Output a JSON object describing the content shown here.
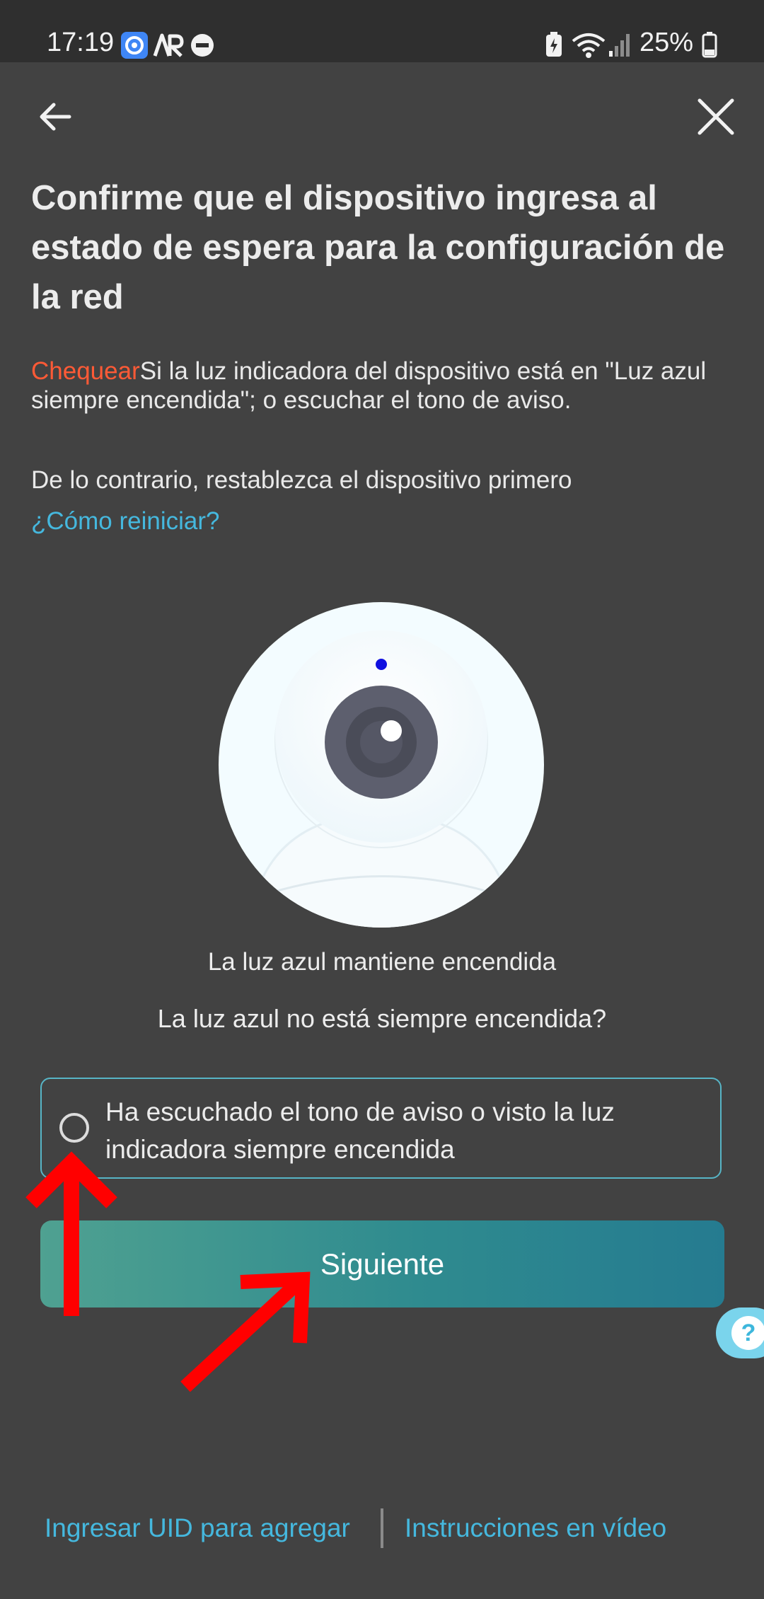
{
  "status_bar": {
    "time": "17:19",
    "battery": "25%",
    "icons": [
      "app-badge-icon",
      "ar-icon",
      "do-not-disturb-icon",
      "battery-saver-icon",
      "wifi-icon",
      "signal-icon",
      "battery-icon"
    ]
  },
  "nav": {
    "back_icon": "arrow-left-icon",
    "close_icon": "close-icon"
  },
  "title": "Confirme que el dispositivo ingresa al estado de espera para la configuración de la red",
  "instructions": {
    "highlight": "Chequear",
    "text": "Si la luz indicadora del dispositivo está en \"Luz azul siempre encendida\"; o escuchar el tono de aviso.",
    "otherwise": "De lo contrario, restablezca el dispositivo primero",
    "reset_link": "¿Cómo reiniciar?"
  },
  "illustration": {
    "caption": "La luz azul mantiene encendida",
    "indicator_color": "#1010e0"
  },
  "light_not_on_link": "La luz azul no está siempre encendida?",
  "confirm_option": {
    "label": "Ha escuchado el tono de aviso o visto la luz indicadora siempre encendida",
    "checked": false
  },
  "next_button": "Siguiente",
  "help_button": "?",
  "footer": {
    "uid_link": "Ingresar UID para agregar",
    "video_link": "Instrucciones en vídeo"
  },
  "colors": {
    "background": "#424242",
    "accent_link": "#45b8de",
    "highlight": "#ff5a36",
    "annotation_arrow": "#ff0000"
  }
}
